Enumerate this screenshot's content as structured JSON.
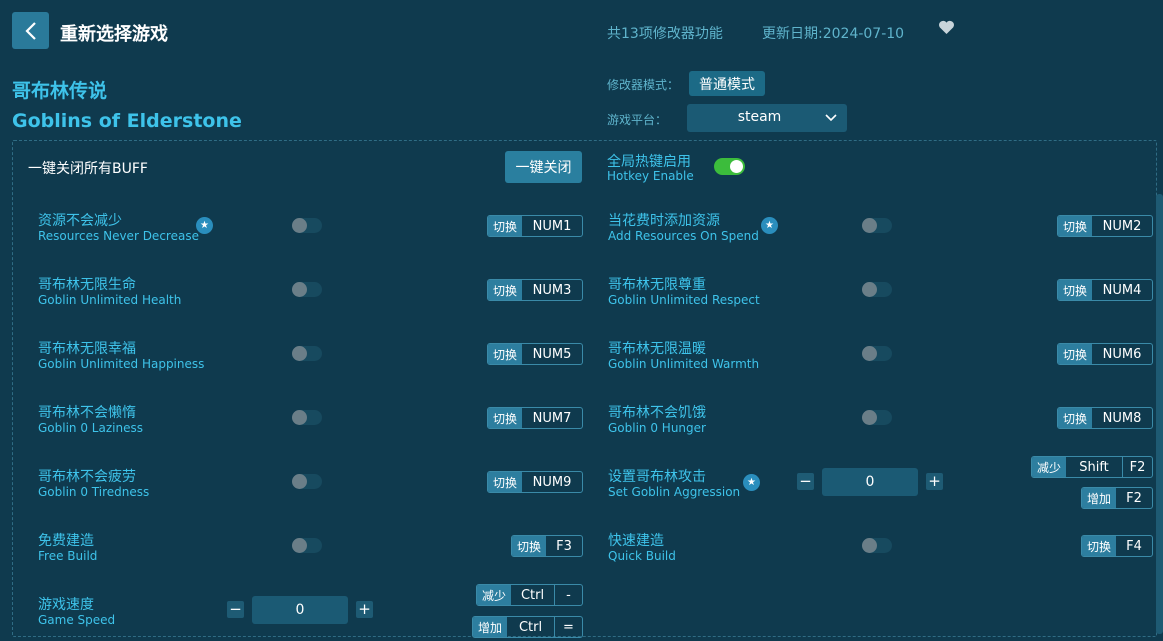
{
  "header": {
    "title": "重新选择游戏",
    "feature_count": "共13项修改器功能",
    "update_date": "更新日期:2024-07-10"
  },
  "game": {
    "name_cn": "哥布林传说",
    "name_en": "Goblins of Elderstone"
  },
  "settings": {
    "mode_label": "修改器模式：",
    "mode_value": "普通模式",
    "platform_label": "游戏平台：",
    "platform_value": "steam"
  },
  "controls": {
    "buff_label": "一键关闭所有BUFF",
    "close_all_button": "一键关闭",
    "hotkey_cn": "全局热键启用",
    "hotkey_en": "Hotkey Enable",
    "hotkey_enabled": true
  },
  "options": [
    {
      "cn": "资源不会减少",
      "en": "Resources Never Decrease",
      "starred": true,
      "tag": "切换",
      "key": "NUM1",
      "enabled": false
    },
    {
      "cn": "当花费时添加资源",
      "en": "Add Resources On Spend",
      "starred": true,
      "tag": "切换",
      "key": "NUM2",
      "enabled": false
    },
    {
      "cn": "哥布林无限生命",
      "en": "Goblin Unlimited Health",
      "starred": false,
      "tag": "切换",
      "key": "NUM3",
      "enabled": false
    },
    {
      "cn": "哥布林无限尊重",
      "en": "Goblin Unlimited Respect",
      "starred": false,
      "tag": "切换",
      "key": "NUM4",
      "enabled": false
    },
    {
      "cn": "哥布林无限幸福",
      "en": "Goblin Unlimited Happiness",
      "starred": false,
      "tag": "切换",
      "key": "NUM5",
      "enabled": false
    },
    {
      "cn": "哥布林无限温暖",
      "en": "Goblin Unlimited Warmth",
      "starred": false,
      "tag": "切换",
      "key": "NUM6",
      "enabled": false
    },
    {
      "cn": "哥布林不会懒惰",
      "en": "Goblin 0 Laziness",
      "starred": false,
      "tag": "切换",
      "key": "NUM7",
      "enabled": false
    },
    {
      "cn": "哥布林不会饥饿",
      "en": "Goblin 0 Hunger",
      "starred": false,
      "tag": "切换",
      "key": "NUM8",
      "enabled": false
    },
    {
      "cn": "哥布林不会疲劳",
      "en": "Goblin 0 Tiredness",
      "starred": false,
      "tag": "切换",
      "key": "NUM9",
      "enabled": false
    },
    {
      "cn": "免费建造",
      "en": "Free Build",
      "starred": false,
      "tag": "切换",
      "key": "F3",
      "enabled": false
    },
    {
      "cn": "快速建造",
      "en": "Quick Build",
      "starred": false,
      "tag": "切换",
      "key": "F4",
      "enabled": false
    }
  ],
  "aggression": {
    "cn": "设置哥布林攻击",
    "en": "Set Goblin Aggression",
    "starred": true,
    "value": "0",
    "minus": "−",
    "plus": "+",
    "dec_tag": "减少",
    "dec_key1": "Shift",
    "dec_key2": "F2",
    "inc_tag": "增加",
    "inc_key": "F2"
  },
  "game_speed": {
    "cn": "游戏速度",
    "en": "Game Speed",
    "value": "0",
    "minus": "−",
    "plus": "+",
    "dec_tag": "减少",
    "dec_key1": "Ctrl",
    "dec_key2": "-",
    "inc_tag": "增加",
    "inc_key1": "Ctrl",
    "inc_key2": "="
  },
  "icons": {
    "back": "chevron-left-icon",
    "heart": "heart-icon",
    "star": "star-icon",
    "dropdown": "chevron-down-icon"
  },
  "colors": {
    "background": "#0f3a4e",
    "accent_text": "#3ec3ea",
    "muted_text": "#5fb4cc",
    "button": "#2a7f9f",
    "toggle_on": "#3cbc3c"
  }
}
